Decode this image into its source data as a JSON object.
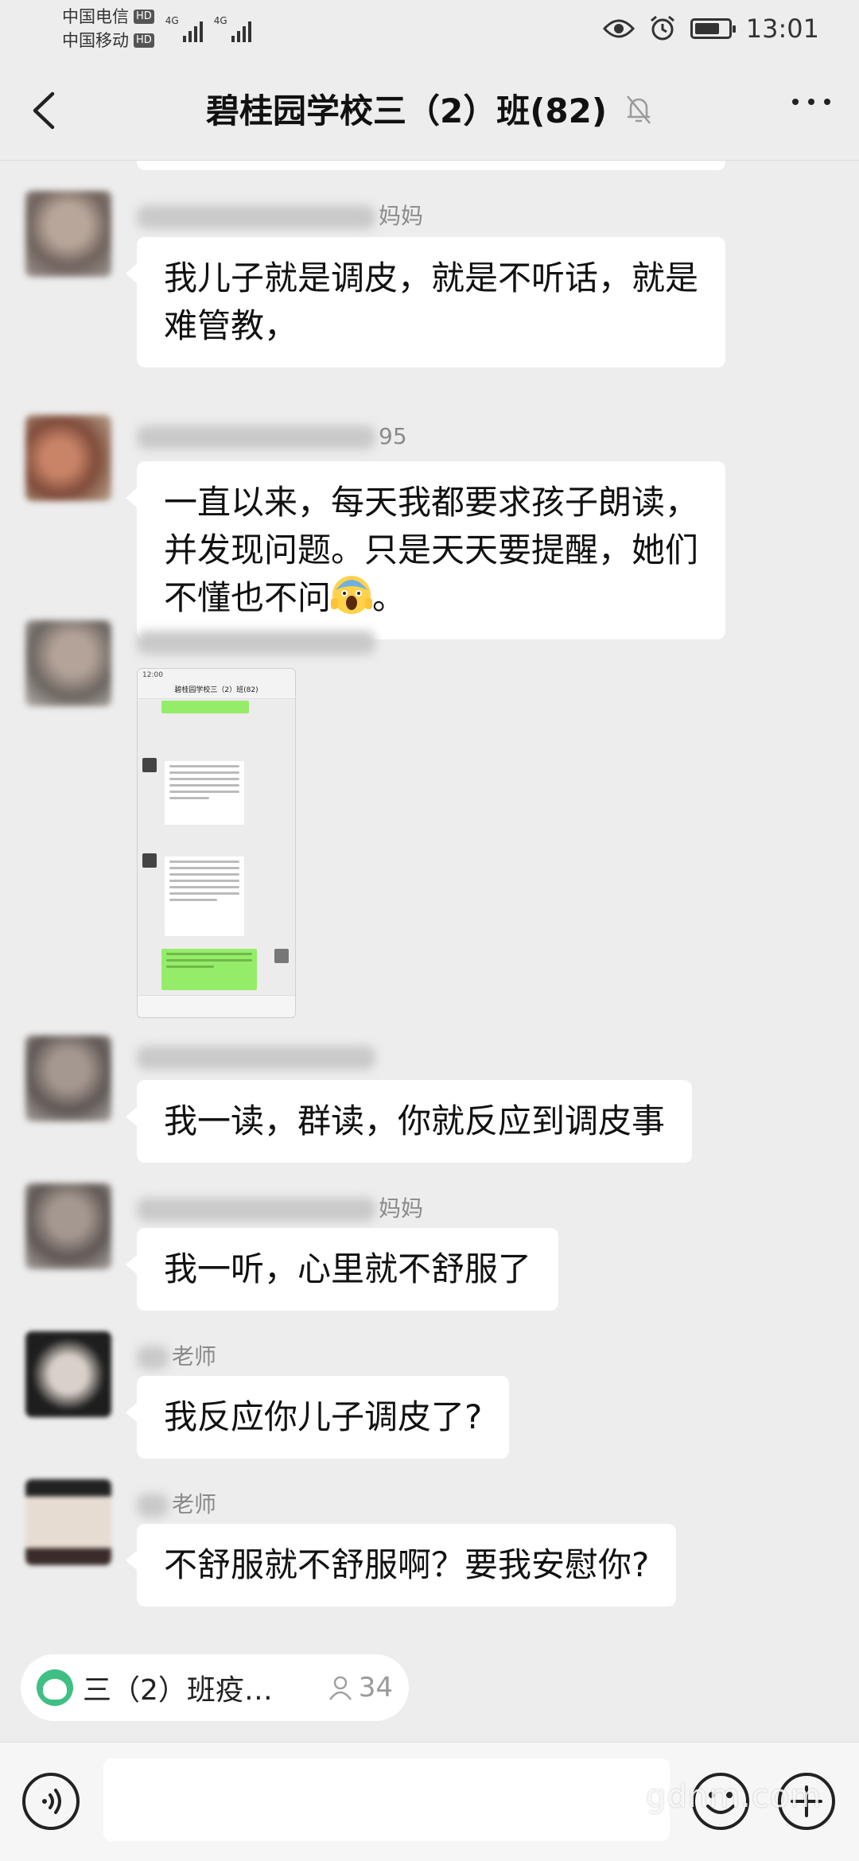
{
  "status_bar": {
    "carrier1": "中国电信",
    "carrier2": "中国移动",
    "hd_badge": "HD",
    "network": "4G",
    "time": "13:01",
    "battery_level": 0.75
  },
  "header": {
    "title": "碧桂园学校三（2）班(82)"
  },
  "messages": [
    {
      "sender_suffix": "妈妈",
      "text": "我儿子就是调皮，就是不听话，就是难管教，",
      "avatar_color": "#7a6d66"
    },
    {
      "sender_suffix": "95",
      "text_before": "一直以来，每天我都要求孩子朗读，并发现问题。只是天天要提醒，她们不懂也不问",
      "text_after": "。",
      "emoji": "scream-emoji",
      "avatar_color": "#8b5a45"
    },
    {
      "sender_suffix": "",
      "image": true,
      "avatar_color": "#6e6864"
    },
    {
      "sender_suffix": "",
      "text": "我一读，群读，你就反应到调皮事",
      "avatar_color": "#6c6360"
    },
    {
      "sender_suffix": "妈妈",
      "text": "我一听，心里就不舒服了",
      "avatar_color": "#6c6360"
    },
    {
      "sender_suffix": "老师",
      "text": "我反应你儿子调皮了?",
      "avatar_color": "#1f1f1f"
    },
    {
      "sender_suffix": "老师",
      "text": "不舒服就不舒服啊？要我安慰你?",
      "avatar_color": "#3a3a3a"
    }
  ],
  "image_preview": {
    "time": "12:00",
    "title": "碧桂园学校三（2）班(82)"
  },
  "pinned": {
    "label": "三（2）班疫…",
    "count": "34"
  },
  "input": {
    "placeholder": ""
  },
  "watermark": "gdnm.com",
  "colors": {
    "background": "#ededed",
    "bubble": "#ffffff",
    "green_accent": "#95ec69"
  }
}
